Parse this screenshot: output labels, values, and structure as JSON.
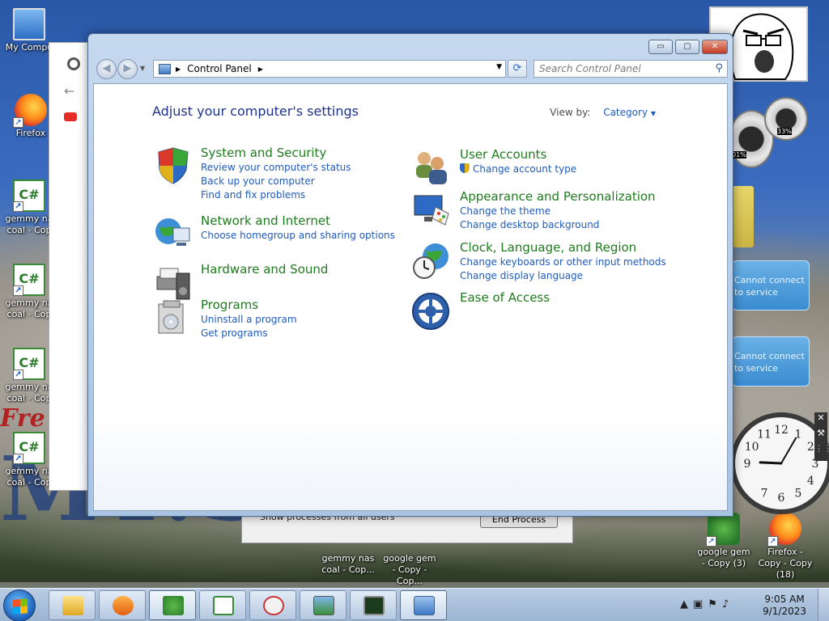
{
  "desktop": {
    "icons": [
      {
        "label": "My Compu",
        "kind": "pc"
      },
      {
        "label": "Firefox",
        "kind": "ff"
      },
      {
        "label": "gemmy na coal - Cop",
        "kind": "cs"
      },
      {
        "label": "gemmy na coal - Cop",
        "kind": "cs"
      },
      {
        "label": "gemmy na coal - Cop",
        "kind": "cs"
      },
      {
        "label": "gemmy na coal - Cop",
        "kind": "cs"
      }
    ],
    "bottom_icons": [
      {
        "label": "gemmy nas coal - Cop..."
      },
      {
        "label": "google gem - Copy - Cop..."
      },
      {
        "label": "google gem - Copy (3)"
      },
      {
        "label": "Firefox - Copy - Copy (18)"
      }
    ],
    "red_text": "Fre",
    "big_text": "MT.S          E"
  },
  "gadgets": {
    "cpu_percent": "33%",
    "mem_percent": "01%",
    "weather_1": "Cannot connect to service",
    "weather_2": "Cannot connect to service",
    "clock_numbers": [
      "12",
      "1",
      "2",
      "3",
      "4",
      "5",
      "6",
      "7",
      "9",
      "10",
      "11"
    ]
  },
  "background": {
    "task_manager": {
      "show_label": "Show processes from all users",
      "end_process": "End Process"
    }
  },
  "window": {
    "title_buttons": {
      "minimize": "▭",
      "maximize": "▢",
      "close": "✕"
    },
    "address": {
      "crumb": "Control Panel"
    },
    "search_placeholder": "Search Control Panel",
    "heading": "Adjust your computer's settings",
    "view_by_label": "View by:",
    "view_by_value": "Category",
    "categories_left": [
      {
        "title": "System and Security",
        "links": [
          "Review your computer's status",
          "Back up your computer",
          "Find and fix problems"
        ]
      },
      {
        "title": "Network and Internet",
        "links": [
          "Choose homegroup and sharing options"
        ]
      },
      {
        "title": "Hardware and Sound",
        "links": []
      },
      {
        "title": "Programs",
        "links": [
          "Uninstall a program",
          "Get programs"
        ]
      }
    ],
    "categories_right": [
      {
        "title": "User Accounts",
        "links": [
          "Change account type"
        ]
      },
      {
        "title": "Appearance and Personalization",
        "links": [
          "Change the theme",
          "Change desktop background"
        ]
      },
      {
        "title": "Clock, Language, and Region",
        "links": [
          "Change keyboards or other input methods",
          "Change display language"
        ]
      },
      {
        "title": "Ease of Access",
        "links": []
      }
    ]
  },
  "taskbar": {
    "time": "9:05 AM",
    "date": "9/1/2023",
    "buttons": [
      "explorer",
      "media-player",
      "gem",
      "csharp",
      "snipping",
      "photo",
      "task-manager",
      "control-panel"
    ]
  },
  "colors": {
    "title_green": "#1e7b1e",
    "link_blue": "#1e5bbf",
    "heading_blue": "#1e3287"
  }
}
